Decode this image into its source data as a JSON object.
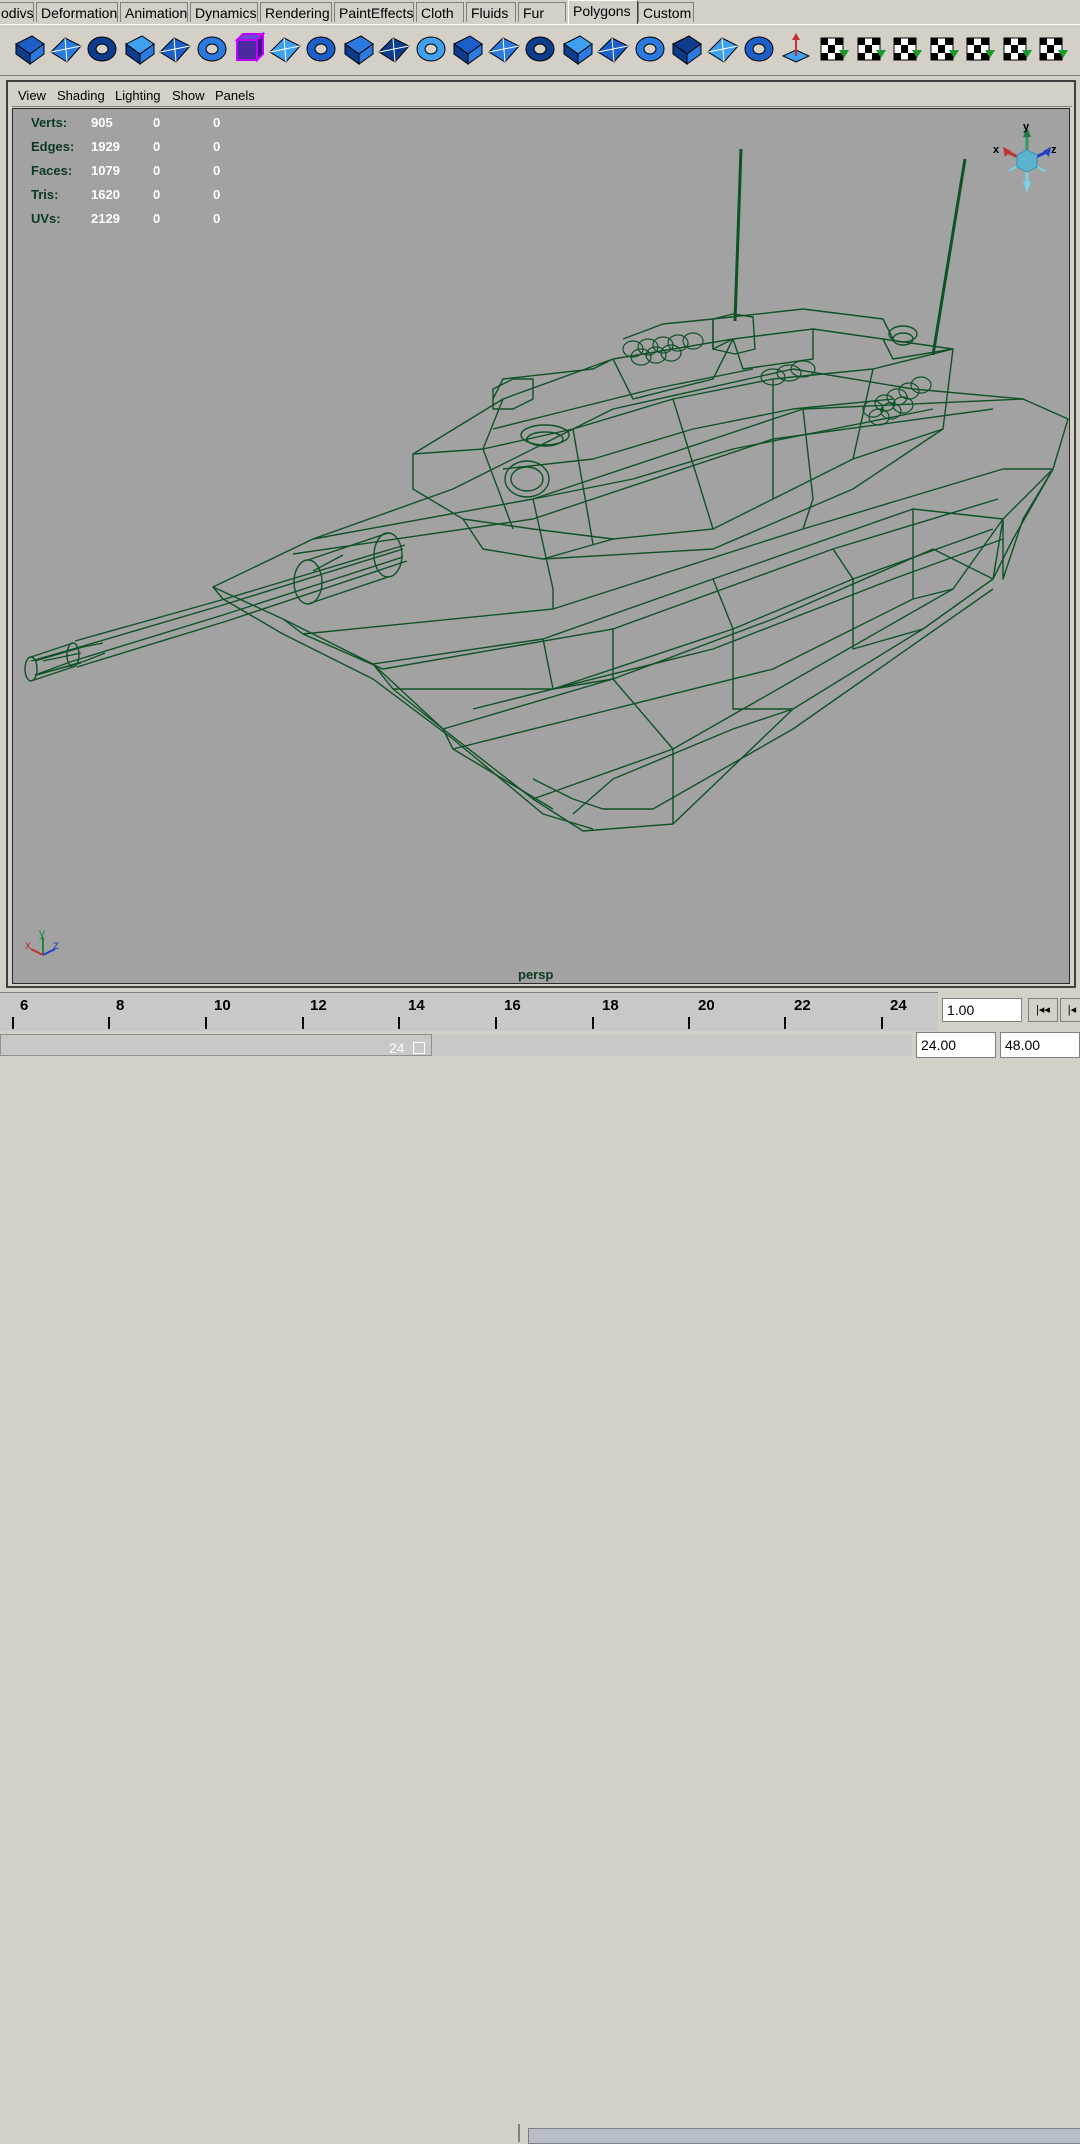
{
  "shelf_tabs": [
    "odivs",
    "Deformation",
    "Animation",
    "Dynamics",
    "Rendering",
    "PaintEffects",
    "Cloth",
    "Fluids",
    "Fur",
    "Polygons",
    "Custom"
  ],
  "active_tab": "Polygons",
  "shelf_icons": [
    "polygon-torus-icon",
    "polygon-sphere-object-icon",
    "merge-vertices-icon",
    "extrude-icon",
    "split-polygon-icon",
    "smooth-icon",
    "cube-wireframe-icon",
    "cut-faces-icon",
    "subdivide-icon",
    "bevel-icon",
    "wedge-icon",
    "poke-face-icon",
    "extrude-face-icon",
    "duplicate-face-icon",
    "extract-icon",
    "split-edge-icon",
    "collapse-icon",
    "merge-edge-icon",
    "bridge-icon",
    "planar-projection-icon",
    "flip-face-icon",
    "move-component-icon",
    "uv-checker-icon",
    "uv-map-icon",
    "uv-normalize-icon",
    "uv-sphere-icon",
    "uv-layout-icon",
    "uv-editor-icon",
    "fill-hole-icon"
  ],
  "viewport": {
    "menu": [
      "View",
      "Shading",
      "Lighting",
      "Show",
      "Panels"
    ],
    "hud": [
      {
        "label": "Verts:",
        "v1": "905",
        "v2": "0",
        "v3": "0"
      },
      {
        "label": "Edges:",
        "v1": "1929",
        "v2": "0",
        "v3": "0"
      },
      {
        "label": "Faces:",
        "v1": "1079",
        "v2": "0",
        "v3": "0"
      },
      {
        "label": "Tris:",
        "v1": "1620",
        "v2": "0",
        "v3": "0"
      },
      {
        "label": "UVs:",
        "v1": "2129",
        "v2": "0",
        "v3": "0"
      }
    ],
    "camera": "persp",
    "axis_labels": {
      "x": "x",
      "y": "y",
      "z": "z"
    },
    "colors": {
      "background": "#a2a2a2",
      "wireframe": "#0f5226",
      "hud_label": "#0c3a20",
      "hud_value": "#ffffff"
    }
  },
  "timeline": {
    "ticks": [
      "6",
      "8",
      "10",
      "12",
      "14",
      "16",
      "18",
      "20",
      "22",
      "24"
    ],
    "current_frame": "1.00",
    "range_end_label": "24",
    "range_start": "24.00",
    "range_end": "48.00"
  }
}
